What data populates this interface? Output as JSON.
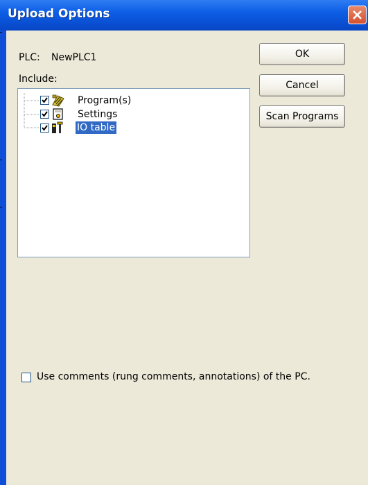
{
  "window": {
    "title": "Upload Options",
    "close_icon": "close-icon"
  },
  "plc": {
    "label": "PLC:",
    "name": "NewPLC1"
  },
  "include_label": "Include:",
  "tree": {
    "items": [
      {
        "label": "Program(s)",
        "checked": true,
        "icon": "program-icon"
      },
      {
        "label": "Settings",
        "checked": true,
        "icon": "settings-icon"
      },
      {
        "label": "IO table",
        "checked": true,
        "icon": "io-table-icon",
        "selected": true
      }
    ]
  },
  "buttons": {
    "ok": "OK",
    "cancel": "Cancel",
    "scan_programs": "Scan Programs"
  },
  "use_comments": {
    "label": "Use comments (rung comments, annotations) of the PC.",
    "checked": false
  },
  "colors": {
    "titlebar": "#0a52d6",
    "dialog_bg": "#ece9d8",
    "selection": "#316ac5",
    "close": "#d4512e"
  }
}
